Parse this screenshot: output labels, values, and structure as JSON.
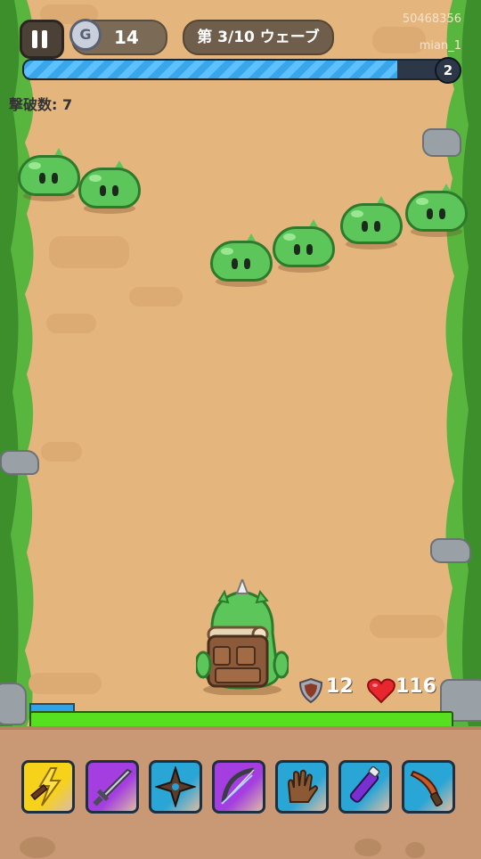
{
  "hud": {
    "coin_count": "14",
    "wave_label": "第 3/10 ウェーブ",
    "watermark_id": "50468356",
    "watermark_user": "mian_1",
    "wave_progress": 0.87,
    "wave_badge": "2",
    "kill_label": "撃破数: 7"
  },
  "player": {
    "armor": "12",
    "hp": "116",
    "hp_fraction": 1.0,
    "exp_fraction": 0.1
  },
  "enemies": [
    {
      "type": "green-slime"
    },
    {
      "type": "green-slime"
    },
    {
      "type": "green-slime"
    },
    {
      "type": "green-slime"
    },
    {
      "type": "green-slime"
    },
    {
      "type": "green-slime"
    }
  ],
  "weapons": [
    {
      "icon": "lightning-dagger-icon",
      "tier_color": "#f7d21a"
    },
    {
      "icon": "sword-icon",
      "tier_color": "#a43ee0"
    },
    {
      "icon": "shuriken-icon",
      "tier_color": "#29a5d6"
    },
    {
      "icon": "bow-icon",
      "tier_color": "#a43ee0"
    },
    {
      "icon": "glove-icon",
      "tier_color": "#29a5d6"
    },
    {
      "icon": "potion-icon",
      "tier_color": "#29a5d6"
    },
    {
      "icon": "knife-icon",
      "tier_color": "#29a5d6"
    }
  ],
  "colors": {
    "slime": "#5cc65a",
    "hp_bar": "#57e01f",
    "wave_progress": "#3aa6ea",
    "path": "#e5b57e"
  }
}
